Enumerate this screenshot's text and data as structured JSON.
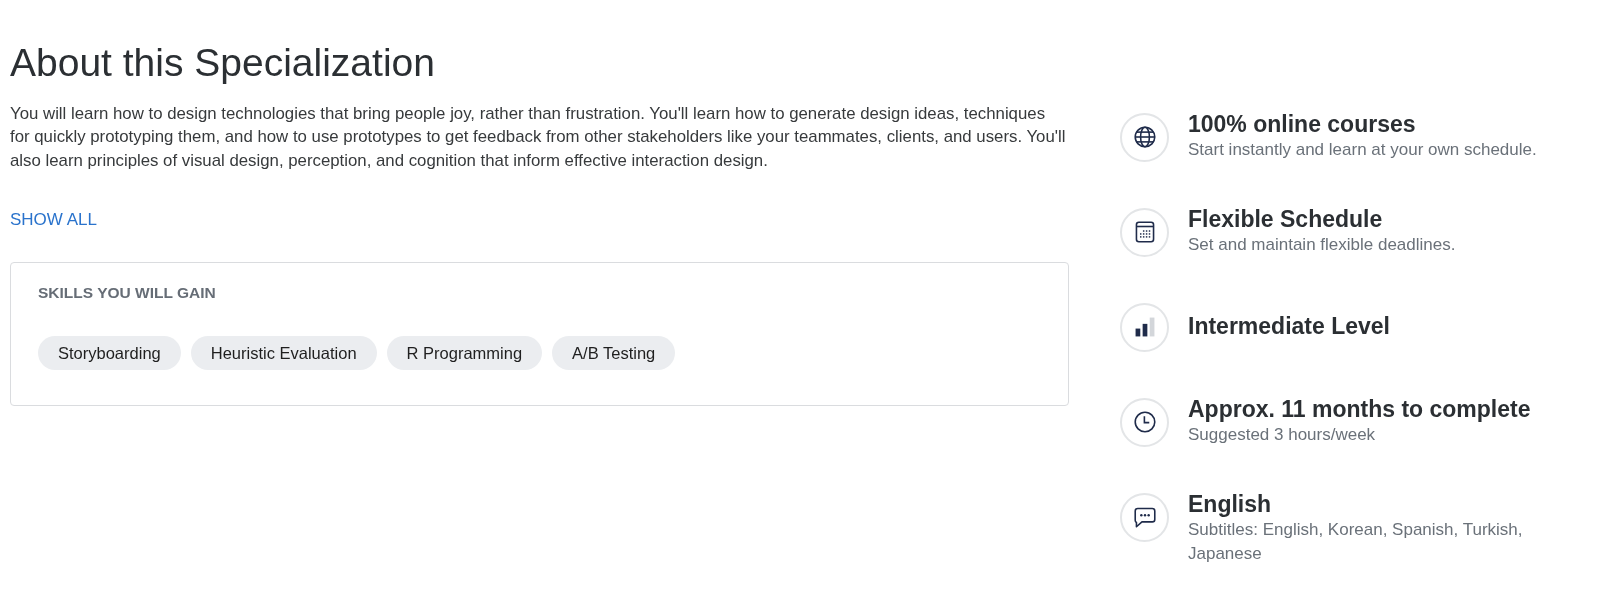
{
  "heading": "About this Specialization",
  "description": "You will learn how to design technologies that bring people joy, rather than frustration. You'll learn how to generate design ideas, techniques for quickly prototyping them, and how to use prototypes to get feedback from other stakeholders like your teammates, clients, and users. You'll also learn principles of visual design, perception, and cognition that inform effective interaction design.",
  "show_all": "SHOW ALL",
  "skills": {
    "title": "SKILLS YOU WILL GAIN",
    "tags": [
      "Storyboarding",
      "Heuristic Evaluation",
      "R Programming",
      "A/B Testing"
    ]
  },
  "features": [
    {
      "kind": "globe",
      "title": "100% online courses",
      "subtitle": "Start instantly and learn at your own schedule."
    },
    {
      "kind": "calendar",
      "title": "Flexible Schedule",
      "subtitle": "Set and maintain flexible deadlines."
    },
    {
      "kind": "level",
      "title": "Intermediate Level"
    },
    {
      "kind": "clock",
      "title": "Approx. 11 months to complete",
      "subtitle": "Suggested 3 hours/week"
    },
    {
      "kind": "chat",
      "title": "English",
      "subtitle": "Subtitles: English, Korean, Spanish, Turkish, Japanese"
    }
  ]
}
